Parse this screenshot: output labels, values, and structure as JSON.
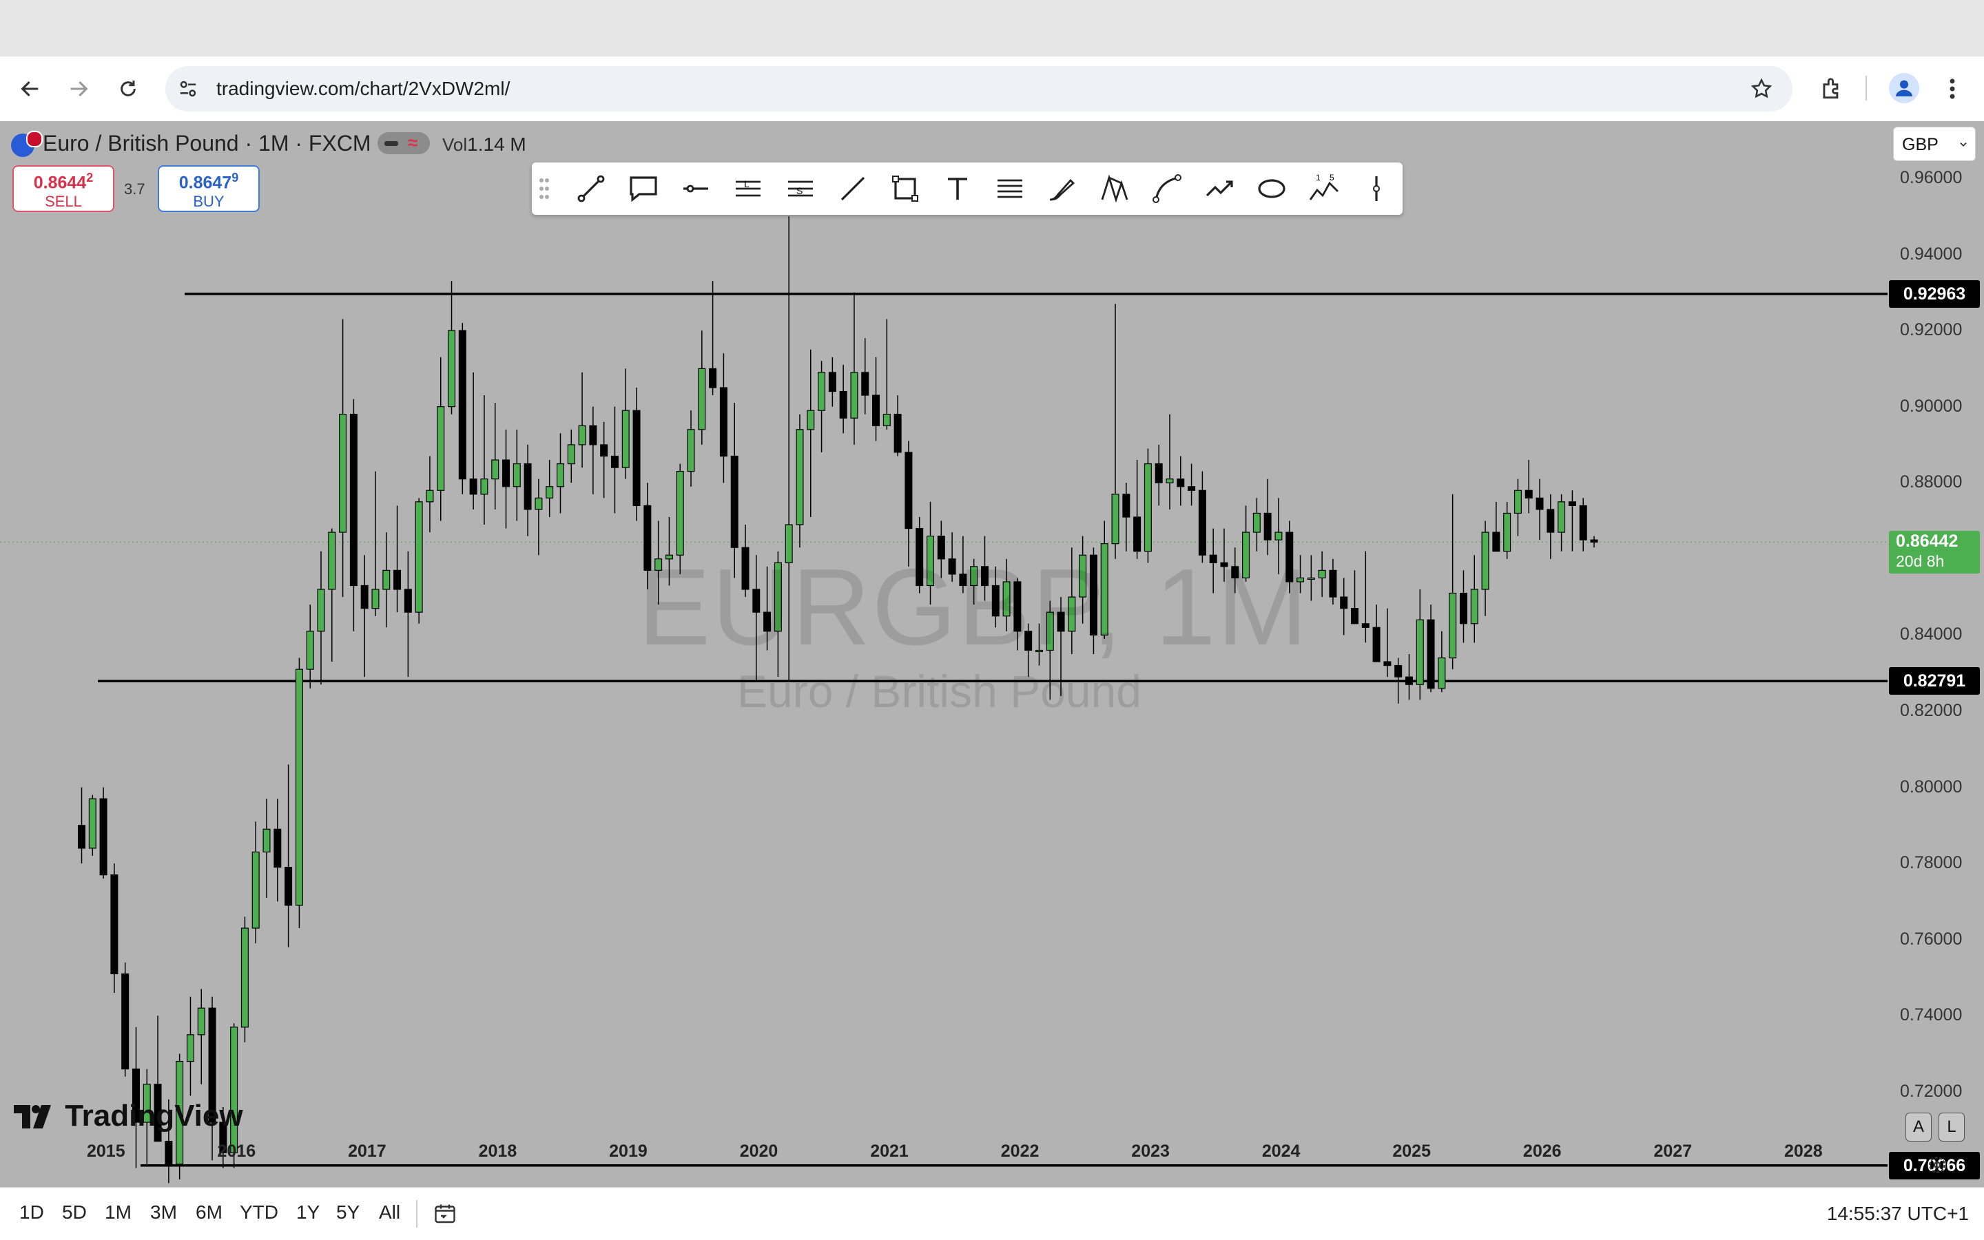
{
  "browser": {
    "url": "tradingview.com/chart/2VxDW2ml/"
  },
  "header": {
    "symbol_title": "Euro / British Pound · 1M · FXCM",
    "vol_label": "Vol",
    "vol_value": "1.14 M",
    "sell_price": "0.8644",
    "sell_price_sup": "2",
    "sell_label": "SELL",
    "buy_price": "0.8647",
    "buy_price_sup": "9",
    "buy_label": "BUY",
    "spread": "3.7",
    "currency": "GBP"
  },
  "watermark": {
    "ticker": "EURGBP, 1M",
    "name": "Euro / British Pound"
  },
  "price_axis": {
    "ticks": [
      "0.96000",
      "0.94000",
      "0.92000",
      "0.90000",
      "0.88000",
      "0.84000",
      "0.82000",
      "0.80000",
      "0.78000",
      "0.76000",
      "0.74000",
      "0.72000"
    ],
    "current_price": "0.86442",
    "countdown": "20d 8h"
  },
  "horizontal_lines": [
    {
      "label": "0.92963",
      "value": 0.92963
    },
    {
      "label": "0.82791",
      "value": 0.82791
    },
    {
      "label": "0.70066",
      "value": 0.70066
    }
  ],
  "time_axis": {
    "years": [
      "2015",
      "2016",
      "2017",
      "2018",
      "2019",
      "2020",
      "2021",
      "2022",
      "2023",
      "2024",
      "2025",
      "2026",
      "2027",
      "2028"
    ]
  },
  "timeframes": [
    "1D",
    "5D",
    "1M",
    "3M",
    "6M",
    "YTD",
    "1Y",
    "5Y",
    "All"
  ],
  "footer": {
    "time": "14:55:37 UTC+1",
    "auto_label": "A",
    "log_label": "L"
  },
  "logo": "TradingView",
  "colors": {
    "chart_bg": "#b3b3b3",
    "up_candle": "#4caf50",
    "down_candle": "#000000",
    "line": "#000000",
    "current_price_flag": "#4caf50"
  },
  "drawing_tools": [
    "trend-line-icon",
    "callout-icon",
    "horizontal-ray-icon",
    "long-position-icon",
    "short-position-icon",
    "line-icon",
    "rectangle-icon",
    "text-icon",
    "parallel-channel-icon",
    "brush-icon",
    "xabcd-pattern-icon",
    "curve-icon",
    "path-icon",
    "ellipse-icon",
    "elliott-wave-icon",
    "vertical-line-icon"
  ],
  "chart_data": {
    "type": "candlestick",
    "symbol": "EURGBP",
    "interval": "1M",
    "ylim": [
      0.695,
      0.975
    ],
    "candles": [
      {
        "t": "2014-10",
        "o": 0.79,
        "h": 0.8,
        "l": 0.78,
        "c": 0.784
      },
      {
        "t": "2014-11",
        "o": 0.784,
        "h": 0.798,
        "l": 0.782,
        "c": 0.797
      },
      {
        "t": "2014-12",
        "o": 0.797,
        "h": 0.8,
        "l": 0.776,
        "c": 0.777
      },
      {
        "t": "2015-01",
        "o": 0.777,
        "h": 0.78,
        "l": 0.746,
        "c": 0.751
      },
      {
        "t": "2015-02",
        "o": 0.751,
        "h": 0.754,
        "l": 0.724,
        "c": 0.726
      },
      {
        "t": "2015-03",
        "o": 0.726,
        "h": 0.737,
        "l": 0.7,
        "c": 0.712
      },
      {
        "t": "2015-04",
        "o": 0.712,
        "h": 0.726,
        "l": 0.701,
        "c": 0.722
      },
      {
        "t": "2015-05",
        "o": 0.722,
        "h": 0.74,
        "l": 0.709,
        "c": 0.707
      },
      {
        "t": "2015-06",
        "o": 0.707,
        "h": 0.718,
        "l": 0.696,
        "c": 0.701
      },
      {
        "t": "2015-07",
        "o": 0.701,
        "h": 0.73,
        "l": 0.697,
        "c": 0.728
      },
      {
        "t": "2015-08",
        "o": 0.728,
        "h": 0.745,
        "l": 0.719,
        "c": 0.735
      },
      {
        "t": "2015-09",
        "o": 0.735,
        "h": 0.747,
        "l": 0.722,
        "c": 0.742
      },
      {
        "t": "2015-10",
        "o": 0.742,
        "h": 0.745,
        "l": 0.702,
        "c": 0.712
      },
      {
        "t": "2015-11",
        "o": 0.712,
        "h": 0.716,
        "l": 0.7,
        "c": 0.704
      },
      {
        "t": "2015-12",
        "o": 0.704,
        "h": 0.738,
        "l": 0.7,
        "c": 0.737
      },
      {
        "t": "2016-01",
        "o": 0.737,
        "h": 0.766,
        "l": 0.733,
        "c": 0.763
      },
      {
        "t": "2016-02",
        "o": 0.763,
        "h": 0.791,
        "l": 0.759,
        "c": 0.783
      },
      {
        "t": "2016-03",
        "o": 0.783,
        "h": 0.797,
        "l": 0.771,
        "c": 0.789
      },
      {
        "t": "2016-04",
        "o": 0.789,
        "h": 0.797,
        "l": 0.77,
        "c": 0.779
      },
      {
        "t": "2016-05",
        "o": 0.779,
        "h": 0.806,
        "l": 0.758,
        "c": 0.769
      },
      {
        "t": "2016-06",
        "o": 0.769,
        "h": 0.834,
        "l": 0.763,
        "c": 0.831
      },
      {
        "t": "2016-07",
        "o": 0.831,
        "h": 0.848,
        "l": 0.826,
        "c": 0.841
      },
      {
        "t": "2016-08",
        "o": 0.841,
        "h": 0.862,
        "l": 0.827,
        "c": 0.852
      },
      {
        "t": "2016-09",
        "o": 0.852,
        "h": 0.868,
        "l": 0.833,
        "c": 0.867
      },
      {
        "t": "2016-10",
        "o": 0.867,
        "h": 0.923,
        "l": 0.85,
        "c": 0.898
      },
      {
        "t": "2016-11",
        "o": 0.898,
        "h": 0.902,
        "l": 0.841,
        "c": 0.853
      },
      {
        "t": "2016-12",
        "o": 0.853,
        "h": 0.861,
        "l": 0.829,
        "c": 0.847
      },
      {
        "t": "2017-01",
        "o": 0.847,
        "h": 0.883,
        "l": 0.845,
        "c": 0.852
      },
      {
        "t": "2017-02",
        "o": 0.852,
        "h": 0.867,
        "l": 0.842,
        "c": 0.857
      },
      {
        "t": "2017-03",
        "o": 0.857,
        "h": 0.874,
        "l": 0.846,
        "c": 0.852
      },
      {
        "t": "2017-04",
        "o": 0.852,
        "h": 0.862,
        "l": 0.829,
        "c": 0.846
      },
      {
        "t": "2017-05",
        "o": 0.846,
        "h": 0.876,
        "l": 0.843,
        "c": 0.875
      },
      {
        "t": "2017-06",
        "o": 0.875,
        "h": 0.887,
        "l": 0.867,
        "c": 0.878
      },
      {
        "t": "2017-07",
        "o": 0.878,
        "h": 0.913,
        "l": 0.87,
        "c": 0.9
      },
      {
        "t": "2017-08",
        "o": 0.9,
        "h": 0.933,
        "l": 0.898,
        "c": 0.92
      },
      {
        "t": "2017-09",
        "o": 0.92,
        "h": 0.922,
        "l": 0.877,
        "c": 0.881
      },
      {
        "t": "2017-10",
        "o": 0.881,
        "h": 0.909,
        "l": 0.873,
        "c": 0.877
      },
      {
        "t": "2017-11",
        "o": 0.877,
        "h": 0.903,
        "l": 0.869,
        "c": 0.881
      },
      {
        "t": "2017-12",
        "o": 0.881,
        "h": 0.901,
        "l": 0.873,
        "c": 0.886
      },
      {
        "t": "2018-01",
        "o": 0.886,
        "h": 0.894,
        "l": 0.868,
        "c": 0.879
      },
      {
        "t": "2018-02",
        "o": 0.879,
        "h": 0.894,
        "l": 0.87,
        "c": 0.885
      },
      {
        "t": "2018-03",
        "o": 0.885,
        "h": 0.89,
        "l": 0.866,
        "c": 0.873
      },
      {
        "t": "2018-04",
        "o": 0.873,
        "h": 0.881,
        "l": 0.861,
        "c": 0.876
      },
      {
        "t": "2018-05",
        "o": 0.876,
        "h": 0.886,
        "l": 0.871,
        "c": 0.879
      },
      {
        "t": "2018-06",
        "o": 0.879,
        "h": 0.893,
        "l": 0.872,
        "c": 0.885
      },
      {
        "t": "2018-07",
        "o": 0.885,
        "h": 0.894,
        "l": 0.88,
        "c": 0.89
      },
      {
        "t": "2018-08",
        "o": 0.89,
        "h": 0.909,
        "l": 0.884,
        "c": 0.895
      },
      {
        "t": "2018-09",
        "o": 0.895,
        "h": 0.9,
        "l": 0.877,
        "c": 0.89
      },
      {
        "t": "2018-10",
        "o": 0.89,
        "h": 0.896,
        "l": 0.876,
        "c": 0.887
      },
      {
        "t": "2018-11",
        "o": 0.887,
        "h": 0.9,
        "l": 0.872,
        "c": 0.884
      },
      {
        "t": "2018-12",
        "o": 0.884,
        "h": 0.91,
        "l": 0.881,
        "c": 0.899
      },
      {
        "t": "2019-01",
        "o": 0.899,
        "h": 0.905,
        "l": 0.87,
        "c": 0.874
      },
      {
        "t": "2019-02",
        "o": 0.874,
        "h": 0.88,
        "l": 0.852,
        "c": 0.857
      },
      {
        "t": "2019-03",
        "o": 0.857,
        "h": 0.87,
        "l": 0.848,
        "c": 0.86
      },
      {
        "t": "2019-04",
        "o": 0.86,
        "h": 0.871,
        "l": 0.853,
        "c": 0.861
      },
      {
        "t": "2019-05",
        "o": 0.861,
        "h": 0.885,
        "l": 0.856,
        "c": 0.883
      },
      {
        "t": "2019-06",
        "o": 0.883,
        "h": 0.899,
        "l": 0.879,
        "c": 0.894
      },
      {
        "t": "2019-07",
        "o": 0.894,
        "h": 0.92,
        "l": 0.89,
        "c": 0.91
      },
      {
        "t": "2019-08",
        "o": 0.91,
        "h": 0.933,
        "l": 0.903,
        "c": 0.905
      },
      {
        "t": "2019-09",
        "o": 0.905,
        "h": 0.914,
        "l": 0.88,
        "c": 0.887
      },
      {
        "t": "2019-10",
        "o": 0.887,
        "h": 0.901,
        "l": 0.855,
        "c": 0.863
      },
      {
        "t": "2019-11",
        "o": 0.863,
        "h": 0.869,
        "l": 0.85,
        "c": 0.852
      },
      {
        "t": "2019-12",
        "o": 0.852,
        "h": 0.861,
        "l": 0.828,
        "c": 0.846
      },
      {
        "t": "2020-01",
        "o": 0.846,
        "h": 0.858,
        "l": 0.836,
        "c": 0.841
      },
      {
        "t": "2020-02",
        "o": 0.841,
        "h": 0.862,
        "l": 0.829,
        "c": 0.859
      },
      {
        "t": "2020-03",
        "o": 0.859,
        "h": 0.95,
        "l": 0.828,
        "c": 0.869
      },
      {
        "t": "2020-04",
        "o": 0.869,
        "h": 0.898,
        "l": 0.863,
        "c": 0.894
      },
      {
        "t": "2020-05",
        "o": 0.894,
        "h": 0.915,
        "l": 0.871,
        "c": 0.899
      },
      {
        "t": "2020-06",
        "o": 0.899,
        "h": 0.912,
        "l": 0.888,
        "c": 0.909
      },
      {
        "t": "2020-07",
        "o": 0.909,
        "h": 0.913,
        "l": 0.9,
        "c": 0.904
      },
      {
        "t": "2020-08",
        "o": 0.904,
        "h": 0.911,
        "l": 0.893,
        "c": 0.897
      },
      {
        "t": "2020-09",
        "o": 0.897,
        "h": 0.93,
        "l": 0.89,
        "c": 0.909
      },
      {
        "t": "2020-10",
        "o": 0.909,
        "h": 0.918,
        "l": 0.898,
        "c": 0.903
      },
      {
        "t": "2020-11",
        "o": 0.903,
        "h": 0.913,
        "l": 0.891,
        "c": 0.895
      },
      {
        "t": "2020-12",
        "o": 0.895,
        "h": 0.923,
        "l": 0.894,
        "c": 0.898
      },
      {
        "t": "2021-01",
        "o": 0.898,
        "h": 0.903,
        "l": 0.887,
        "c": 0.888
      },
      {
        "t": "2021-02",
        "o": 0.888,
        "h": 0.891,
        "l": 0.858,
        "c": 0.868
      },
      {
        "t": "2021-03",
        "o": 0.868,
        "h": 0.871,
        "l": 0.851,
        "c": 0.853
      },
      {
        "t": "2021-04",
        "o": 0.853,
        "h": 0.875,
        "l": 0.848,
        "c": 0.866
      },
      {
        "t": "2021-05",
        "o": 0.866,
        "h": 0.87,
        "l": 0.855,
        "c": 0.86
      },
      {
        "t": "2021-06",
        "o": 0.86,
        "h": 0.867,
        "l": 0.854,
        "c": 0.856
      },
      {
        "t": "2021-07",
        "o": 0.856,
        "h": 0.866,
        "l": 0.851,
        "c": 0.853
      },
      {
        "t": "2021-08",
        "o": 0.853,
        "h": 0.86,
        "l": 0.848,
        "c": 0.858
      },
      {
        "t": "2021-09",
        "o": 0.858,
        "h": 0.866,
        "l": 0.849,
        "c": 0.853
      },
      {
        "t": "2021-10",
        "o": 0.853,
        "h": 0.858,
        "l": 0.842,
        "c": 0.845
      },
      {
        "t": "2021-11",
        "o": 0.845,
        "h": 0.86,
        "l": 0.841,
        "c": 0.854
      },
      {
        "t": "2021-12",
        "o": 0.854,
        "h": 0.855,
        "l": 0.836,
        "c": 0.841
      },
      {
        "t": "2022-01",
        "o": 0.841,
        "h": 0.843,
        "l": 0.829,
        "c": 0.836
      },
      {
        "t": "2022-02",
        "o": 0.836,
        "h": 0.843,
        "l": 0.832,
        "c": 0.836
      },
      {
        "t": "2022-03",
        "o": 0.836,
        "h": 0.849,
        "l": 0.823,
        "c": 0.846
      },
      {
        "t": "2022-04",
        "o": 0.846,
        "h": 0.85,
        "l": 0.824,
        "c": 0.841
      },
      {
        "t": "2022-05",
        "o": 0.841,
        "h": 0.863,
        "l": 0.835,
        "c": 0.85
      },
      {
        "t": "2022-06",
        "o": 0.85,
        "h": 0.866,
        "l": 0.843,
        "c": 0.861
      },
      {
        "t": "2022-07",
        "o": 0.861,
        "h": 0.863,
        "l": 0.835,
        "c": 0.84
      },
      {
        "t": "2022-08",
        "o": 0.84,
        "h": 0.87,
        "l": 0.839,
        "c": 0.864
      },
      {
        "t": "2022-09",
        "o": 0.864,
        "h": 0.927,
        "l": 0.86,
        "c": 0.877
      },
      {
        "t": "2022-10",
        "o": 0.877,
        "h": 0.88,
        "l": 0.862,
        "c": 0.871
      },
      {
        "t": "2022-11",
        "o": 0.871,
        "h": 0.886,
        "l": 0.86,
        "c": 0.862
      },
      {
        "t": "2022-12",
        "o": 0.862,
        "h": 0.889,
        "l": 0.859,
        "c": 0.885
      },
      {
        "t": "2023-01",
        "o": 0.885,
        "h": 0.89,
        "l": 0.874,
        "c": 0.88
      },
      {
        "t": "2023-02",
        "o": 0.88,
        "h": 0.898,
        "l": 0.873,
        "c": 0.881
      },
      {
        "t": "2023-03",
        "o": 0.881,
        "h": 0.887,
        "l": 0.874,
        "c": 0.879
      },
      {
        "t": "2023-04",
        "o": 0.879,
        "h": 0.885,
        "l": 0.874,
        "c": 0.878
      },
      {
        "t": "2023-05",
        "o": 0.878,
        "h": 0.883,
        "l": 0.859,
        "c": 0.861
      },
      {
        "t": "2023-06",
        "o": 0.861,
        "h": 0.868,
        "l": 0.851,
        "c": 0.859
      },
      {
        "t": "2023-07",
        "o": 0.859,
        "h": 0.868,
        "l": 0.854,
        "c": 0.858
      },
      {
        "t": "2023-08",
        "o": 0.858,
        "h": 0.863,
        "l": 0.851,
        "c": 0.855
      },
      {
        "t": "2023-09",
        "o": 0.855,
        "h": 0.874,
        "l": 0.854,
        "c": 0.867
      },
      {
        "t": "2023-10",
        "o": 0.867,
        "h": 0.876,
        "l": 0.862,
        "c": 0.872
      },
      {
        "t": "2023-11",
        "o": 0.872,
        "h": 0.881,
        "l": 0.861,
        "c": 0.865
      },
      {
        "t": "2023-12",
        "o": 0.865,
        "h": 0.876,
        "l": 0.856,
        "c": 0.867
      },
      {
        "t": "2024-01",
        "o": 0.867,
        "h": 0.87,
        "l": 0.851,
        "c": 0.854
      },
      {
        "t": "2024-02",
        "o": 0.854,
        "h": 0.861,
        "l": 0.851,
        "c": 0.855
      },
      {
        "t": "2024-03",
        "o": 0.855,
        "h": 0.861,
        "l": 0.849,
        "c": 0.855
      },
      {
        "t": "2024-04",
        "o": 0.855,
        "h": 0.862,
        "l": 0.85,
        "c": 0.857
      },
      {
        "t": "2024-05",
        "o": 0.857,
        "h": 0.86,
        "l": 0.848,
        "c": 0.85
      },
      {
        "t": "2024-06",
        "o": 0.85,
        "h": 0.855,
        "l": 0.84,
        "c": 0.847
      },
      {
        "t": "2024-07",
        "o": 0.847,
        "h": 0.857,
        "l": 0.843,
        "c": 0.843
      },
      {
        "t": "2024-08",
        "o": 0.843,
        "h": 0.862,
        "l": 0.838,
        "c": 0.842
      },
      {
        "t": "2024-09",
        "o": 0.842,
        "h": 0.848,
        "l": 0.833,
        "c": 0.833
      },
      {
        "t": "2024-10",
        "o": 0.833,
        "h": 0.847,
        "l": 0.829,
        "c": 0.832
      },
      {
        "t": "2024-11",
        "o": 0.832,
        "h": 0.834,
        "l": 0.822,
        "c": 0.829
      },
      {
        "t": "2024-12",
        "o": 0.829,
        "h": 0.835,
        "l": 0.823,
        "c": 0.827
      },
      {
        "t": "2025-01",
        "o": 0.827,
        "h": 0.852,
        "l": 0.823,
        "c": 0.844
      },
      {
        "t": "2025-02",
        "o": 0.844,
        "h": 0.848,
        "l": 0.825,
        "c": 0.826
      },
      {
        "t": "2025-03",
        "o": 0.826,
        "h": 0.841,
        "l": 0.825,
        "c": 0.834
      },
      {
        "t": "2025-04",
        "o": 0.834,
        "h": 0.877,
        "l": 0.831,
        "c": 0.851
      },
      {
        "t": "2025-05",
        "o": 0.851,
        "h": 0.857,
        "l": 0.838,
        "c": 0.843
      },
      {
        "t": "2025-06",
        "o": 0.843,
        "h": 0.861,
        "l": 0.838,
        "c": 0.852
      },
      {
        "t": "2025-07",
        "o": 0.852,
        "h": 0.87,
        "l": 0.845,
        "c": 0.867
      },
      {
        "t": "2025-08",
        "o": 0.867,
        "h": 0.875,
        "l": 0.862,
        "c": 0.862
      },
      {
        "t": "2025-09",
        "o": 0.862,
        "h": 0.875,
        "l": 0.86,
        "c": 0.872
      },
      {
        "t": "2025-10",
        "o": 0.872,
        "h": 0.881,
        "l": 0.866,
        "c": 0.878
      },
      {
        "t": "2025-11",
        "o": 0.878,
        "h": 0.886,
        "l": 0.872,
        "c": 0.876
      },
      {
        "t": "2025-12",
        "o": 0.876,
        "h": 0.881,
        "l": 0.865,
        "c": 0.873
      },
      {
        "t": "2026-01",
        "o": 0.873,
        "h": 0.877,
        "l": 0.86,
        "c": 0.867
      },
      {
        "t": "2026-02",
        "o": 0.867,
        "h": 0.877,
        "l": 0.862,
        "c": 0.875
      },
      {
        "t": "2026-03",
        "o": 0.875,
        "h": 0.878,
        "l": 0.862,
        "c": 0.874
      },
      {
        "t": "2026-04",
        "o": 0.874,
        "h": 0.876,
        "l": 0.862,
        "c": 0.865
      },
      {
        "t": "2026-05",
        "o": 0.865,
        "h": 0.866,
        "l": 0.863,
        "c": 0.8644
      }
    ]
  }
}
